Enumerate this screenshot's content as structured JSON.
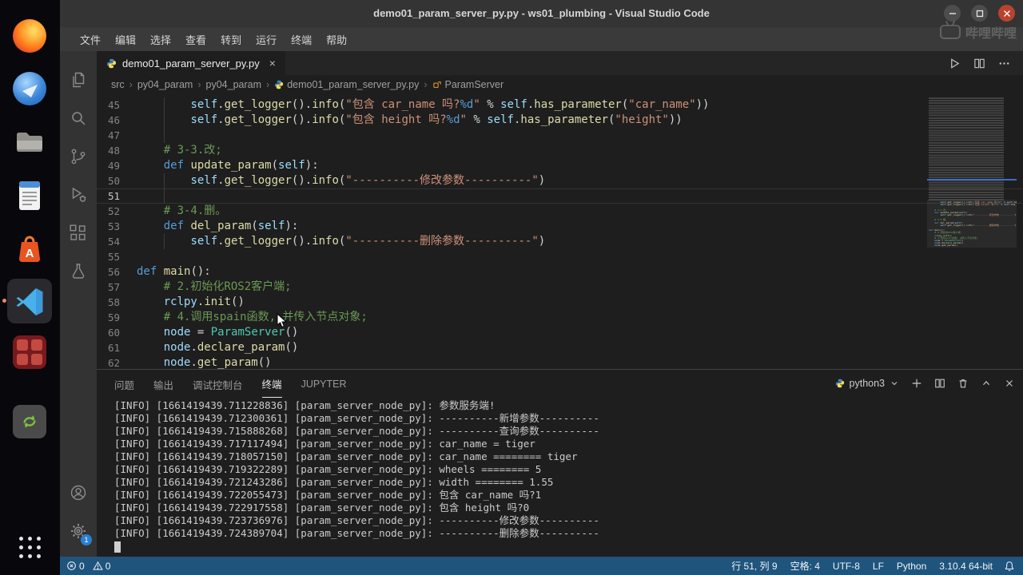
{
  "window": {
    "title": "demo01_param_server_py.py - ws01_plumbing - Visual Studio Code"
  },
  "watermark": {
    "text": "哔哩哔哩"
  },
  "icons": {
    "close": "×",
    "chevron": "›"
  },
  "menu": {
    "items": [
      "文件",
      "编辑",
      "选择",
      "查看",
      "转到",
      "运行",
      "终端",
      "帮助"
    ]
  },
  "dock": {
    "items": [
      "firefox",
      "thunderbird",
      "files",
      "text-editor",
      "ubuntu-software",
      "vscode",
      "media-app",
      "software-updater",
      "app-grid"
    ]
  },
  "activity": {
    "items": [
      "explorer",
      "search",
      "source-control",
      "run-and-debug",
      "extensions",
      "testing",
      "account",
      "settings"
    ],
    "settings_badge": "1"
  },
  "tabs": {
    "active": {
      "label": "demo01_param_server_py.py"
    }
  },
  "breadcrumb": {
    "items": [
      {
        "label": "src"
      },
      {
        "label": "py04_param"
      },
      {
        "label": "py04_param"
      },
      {
        "label": "demo01_param_server_py.py",
        "icon": "python-file-icon"
      },
      {
        "label": "ParamServer",
        "icon": "symbol-class-icon"
      }
    ]
  },
  "editor": {
    "cursor_line": 51,
    "lines": [
      {
        "n": 45,
        "g": 1,
        "t": [
          [
            "ws",
            "        "
          ],
          [
            "v",
            "self"
          ],
          [
            "p",
            "."
          ],
          [
            "f",
            "get_logger"
          ],
          [
            "p",
            "()."
          ],
          [
            "f",
            "info"
          ],
          [
            "p",
            "("
          ],
          [
            "s",
            "\"包含 car_name 吗?"
          ],
          [
            "m",
            "%d"
          ],
          [
            "s",
            "\""
          ],
          [
            "p",
            " "
          ],
          [
            "o",
            "%"
          ],
          [
            "p",
            " "
          ],
          [
            "v",
            "self"
          ],
          [
            "p",
            "."
          ],
          [
            "f",
            "has_parameter"
          ],
          [
            "p",
            "("
          ],
          [
            "s",
            "\"car_name\""
          ],
          [
            "p",
            "))"
          ]
        ]
      },
      {
        "n": 46,
        "g": 1,
        "t": [
          [
            "ws",
            "        "
          ],
          [
            "v",
            "self"
          ],
          [
            "p",
            "."
          ],
          [
            "f",
            "get_logger"
          ],
          [
            "p",
            "()."
          ],
          [
            "f",
            "info"
          ],
          [
            "p",
            "("
          ],
          [
            "s",
            "\"包含 height 吗?"
          ],
          [
            "m",
            "%d"
          ],
          [
            "s",
            "\""
          ],
          [
            "p",
            " "
          ],
          [
            "o",
            "%"
          ],
          [
            "p",
            " "
          ],
          [
            "v",
            "self"
          ],
          [
            "p",
            "."
          ],
          [
            "f",
            "has_parameter"
          ],
          [
            "p",
            "("
          ],
          [
            "s",
            "\"height\""
          ],
          [
            "p",
            "))"
          ]
        ]
      },
      {
        "n": 47,
        "g": 1,
        "t": []
      },
      {
        "n": 48,
        "g": 0,
        "t": [
          [
            "ws",
            "    "
          ],
          [
            "c",
            "# 3-3.改;"
          ]
        ]
      },
      {
        "n": 49,
        "g": 0,
        "t": [
          [
            "ws",
            "    "
          ],
          [
            "k",
            "def"
          ],
          [
            "p",
            " "
          ],
          [
            "f",
            "update_param"
          ],
          [
            "p",
            "("
          ],
          [
            "v",
            "self"
          ],
          [
            "p",
            "):"
          ]
        ]
      },
      {
        "n": 50,
        "g": 1,
        "t": [
          [
            "ws",
            "        "
          ],
          [
            "v",
            "self"
          ],
          [
            "p",
            "."
          ],
          [
            "f",
            "get_logger"
          ],
          [
            "p",
            "()."
          ],
          [
            "f",
            "info"
          ],
          [
            "p",
            "("
          ],
          [
            "s",
            "\"----------修改参数----------\""
          ],
          [
            "p",
            ")"
          ]
        ]
      },
      {
        "n": 51,
        "g": 1,
        "t": []
      },
      {
        "n": 52,
        "g": 0,
        "t": [
          [
            "ws",
            "    "
          ],
          [
            "c",
            "# 3-4.删。"
          ]
        ]
      },
      {
        "n": 53,
        "g": 0,
        "t": [
          [
            "ws",
            "    "
          ],
          [
            "k",
            "def"
          ],
          [
            "p",
            " "
          ],
          [
            "f",
            "del_param"
          ],
          [
            "p",
            "("
          ],
          [
            "v",
            "self"
          ],
          [
            "p",
            "):"
          ]
        ]
      },
      {
        "n": 54,
        "g": 1,
        "t": [
          [
            "ws",
            "        "
          ],
          [
            "v",
            "self"
          ],
          [
            "p",
            "."
          ],
          [
            "f",
            "get_logger"
          ],
          [
            "p",
            "()."
          ],
          [
            "f",
            "info"
          ],
          [
            "p",
            "("
          ],
          [
            "s",
            "\"----------删除参数----------\""
          ],
          [
            "p",
            ")"
          ]
        ]
      },
      {
        "n": 55,
        "g": 0,
        "t": []
      },
      {
        "n": 56,
        "g": 0,
        "t": [
          [
            "k",
            "def"
          ],
          [
            "p",
            " "
          ],
          [
            "f",
            "main"
          ],
          [
            "p",
            "():"
          ]
        ]
      },
      {
        "n": 57,
        "g": 0,
        "t": [
          [
            "ws",
            "    "
          ],
          [
            "c",
            "# 2.初始化ROS2客户端;"
          ]
        ]
      },
      {
        "n": 58,
        "g": 0,
        "t": [
          [
            "ws",
            "    "
          ],
          [
            "v",
            "rclpy"
          ],
          [
            "p",
            "."
          ],
          [
            "f",
            "init"
          ],
          [
            "p",
            "()"
          ]
        ]
      },
      {
        "n": 59,
        "g": 0,
        "t": [
          [
            "ws",
            "    "
          ],
          [
            "c",
            "# 4.调用spain函数, 并传入节点对象;"
          ]
        ]
      },
      {
        "n": 60,
        "g": 0,
        "t": [
          [
            "ws",
            "    "
          ],
          [
            "v",
            "node"
          ],
          [
            "p",
            " "
          ],
          [
            "o",
            "="
          ],
          [
            "p",
            " "
          ],
          [
            "cl",
            "ParamServer"
          ],
          [
            "p",
            "()"
          ]
        ]
      },
      {
        "n": 61,
        "g": 0,
        "t": [
          [
            "ws",
            "    "
          ],
          [
            "v",
            "node"
          ],
          [
            "p",
            "."
          ],
          [
            "f",
            "declare_param"
          ],
          [
            "p",
            "()"
          ]
        ]
      },
      {
        "n": 62,
        "g": 0,
        "t": [
          [
            "ws",
            "    "
          ],
          [
            "v",
            "node"
          ],
          [
            "p",
            "."
          ],
          [
            "f",
            "get_param"
          ],
          [
            "p",
            "()"
          ]
        ]
      }
    ]
  },
  "panel": {
    "tabs": [
      {
        "label": "问题",
        "active": false
      },
      {
        "label": "输出",
        "active": false
      },
      {
        "label": "调试控制台",
        "active": false
      },
      {
        "label": "终端",
        "active": true
      },
      {
        "label": "JUPYTER",
        "active": false
      }
    ],
    "shell": {
      "label": "python3"
    }
  },
  "terminal": {
    "lines": [
      "[INFO] [1661419439.711228836] [param_server_node_py]: 参数服务端!",
      "[INFO] [1661419439.712300361] [param_server_node_py]: ----------新增参数----------",
      "[INFO] [1661419439.715888268] [param_server_node_py]: ----------查询参数----------",
      "[INFO] [1661419439.717117494] [param_server_node_py]: car_name = tiger",
      "[INFO] [1661419439.718057150] [param_server_node_py]: car_name ======== tiger",
      "[INFO] [1661419439.719322289] [param_server_node_py]: wheels ======== 5",
      "[INFO] [1661419439.721243286] [param_server_node_py]: width ======== 1.55",
      "[INFO] [1661419439.722055473] [param_server_node_py]: 包含 car_name 吗?1",
      "[INFO] [1661419439.722917558] [param_server_node_py]: 包含 height 吗?0",
      "[INFO] [1661419439.723736976] [param_server_node_py]: ----------修改参数----------",
      "[INFO] [1661419439.724389704] [param_server_node_py]: ----------删除参数----------"
    ]
  },
  "status": {
    "problems": {
      "errors": "0",
      "warnings": "0"
    },
    "right": [
      {
        "name": "cursor-position",
        "label": "行 51, 列 9"
      },
      {
        "name": "indentation",
        "label": "空格: 4"
      },
      {
        "name": "encoding",
        "label": "UTF-8"
      },
      {
        "name": "eol",
        "label": "LF"
      },
      {
        "name": "language",
        "label": "Python"
      },
      {
        "name": "interpreter",
        "label": "3.10.4 64-bit"
      }
    ]
  },
  "colors": {
    "accent": "#2b7fd4",
    "statusbar": "#1f547d",
    "close_button": "#b8432f"
  }
}
